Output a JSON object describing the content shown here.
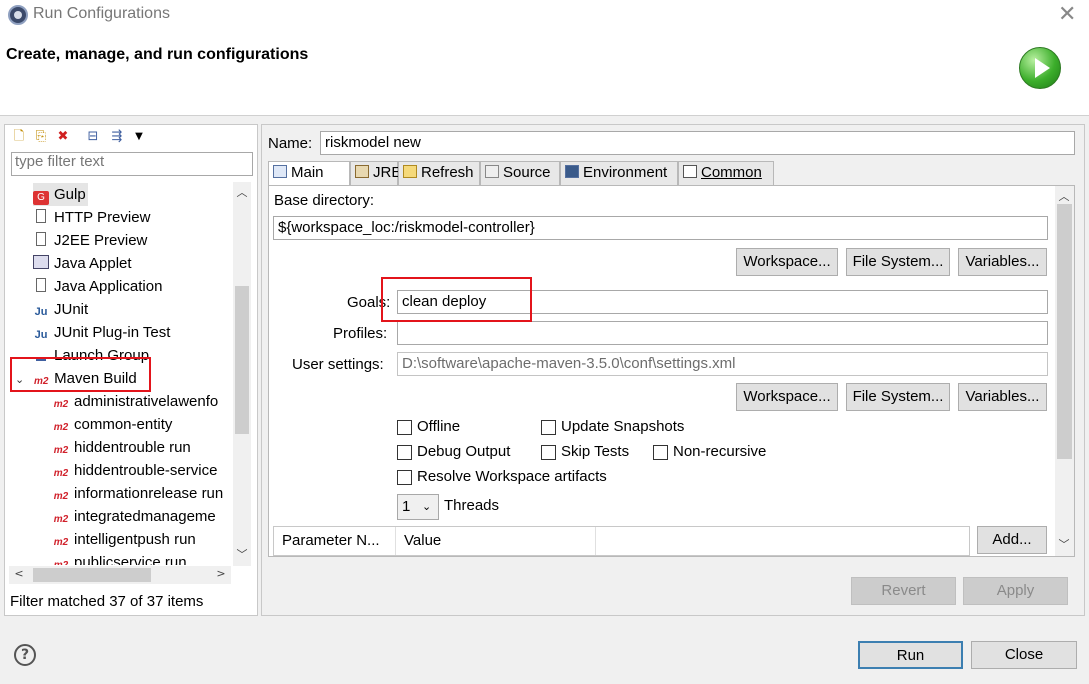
{
  "window": {
    "title": "Run Configurations"
  },
  "header": {
    "title": "Create, manage, and run configurations"
  },
  "left": {
    "filter_placeholder": "type filter text",
    "items": [
      {
        "label": "Gulp",
        "icon": "gulp-icon"
      },
      {
        "label": "HTTP Preview",
        "icon": "http-preview-icon"
      },
      {
        "label": "J2EE Preview",
        "icon": "j2ee-preview-icon"
      },
      {
        "label": "Java Applet",
        "icon": "java-applet-icon"
      },
      {
        "label": "Java Application",
        "icon": "java-application-icon"
      },
      {
        "label": "JUnit",
        "icon": "junit-icon"
      },
      {
        "label": "JUnit Plug-in Test",
        "icon": "junit-plugin-icon"
      },
      {
        "label": "Launch Group",
        "icon": "launch-group-icon"
      },
      {
        "label": "Maven Build",
        "icon": "maven-icon"
      },
      {
        "label": "administrativelawenfo",
        "icon": "maven-icon"
      },
      {
        "label": "common-entity",
        "icon": "maven-icon"
      },
      {
        "label": "hiddentrouble run",
        "icon": "maven-icon"
      },
      {
        "label": "hiddentrouble-service",
        "icon": "maven-icon"
      },
      {
        "label": "informationrelease run",
        "icon": "maven-icon"
      },
      {
        "label": "integratedmanageme",
        "icon": "maven-icon"
      },
      {
        "label": "intelligentpush run",
        "icon": "maven-icon"
      },
      {
        "label": "publicservice run",
        "icon": "maven-icon"
      }
    ],
    "status": "Filter matched 37 of 37 items"
  },
  "right": {
    "name_label": "Name:",
    "name_value": "riskmodel  new",
    "tabs": [
      "Main",
      "JRE",
      "Refresh",
      "Source",
      "Environment",
      "Common"
    ],
    "base_dir_label": "Base directory:",
    "base_dir_value": "${workspace_loc:/riskmodel-controller}",
    "buttons_row1": [
      "Workspace...",
      "File System...",
      "Variables..."
    ],
    "goals_label": "Goals:",
    "goals_value": "clean deploy",
    "profiles_label": "Profiles:",
    "profiles_value": "",
    "user_settings_label": "User settings:",
    "user_settings_value": "D:\\software\\apache-maven-3.5.0\\conf\\settings.xml",
    "buttons_row2": [
      "Workspace...",
      "File System...",
      "Variables..."
    ],
    "checkboxes": {
      "offline": "Offline",
      "update_snapshots": "Update Snapshots",
      "debug_output": "Debug Output",
      "skip_tests": "Skip Tests",
      "non_recursive": "Non-recursive",
      "resolve_workspace": "Resolve Workspace artifacts"
    },
    "threads_value": "1",
    "threads_label": "Threads",
    "param_headers": [
      "Parameter N...",
      "Value"
    ],
    "add_button": "Add...",
    "revert_button": "Revert",
    "apply_button": "Apply"
  },
  "footer": {
    "help_icon": "?",
    "run_button": "Run",
    "close_button": "Close"
  },
  "colors": {
    "highlight_box": "#e3141b",
    "selection": "#cce8ff"
  }
}
